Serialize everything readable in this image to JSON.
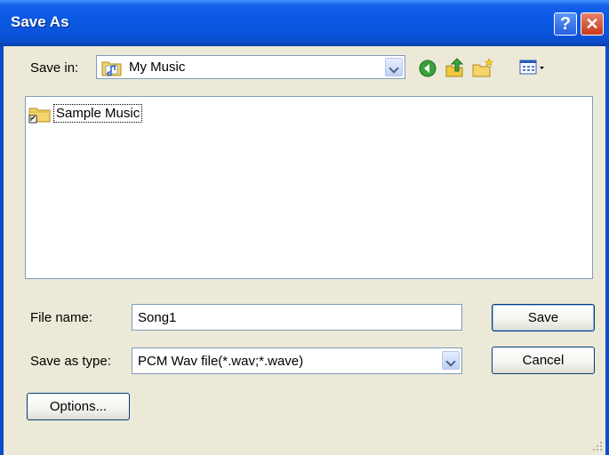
{
  "window": {
    "title": "Save As"
  },
  "title_buttons": {
    "help": "?",
    "close": "✕"
  },
  "save_in": {
    "label": "Save in:",
    "value": "My Music"
  },
  "toolbar": [
    "back-icon",
    "up-folder-icon",
    "new-folder-icon",
    "view-menu-icon"
  ],
  "files": [
    {
      "name": "Sample Music",
      "icon": "folder-shortcut-icon"
    }
  ],
  "file_name": {
    "label": "File name:",
    "value": "Song1"
  },
  "save_as_type": {
    "label": "Save as type:",
    "value": "PCM Wav file(*.wav;*.wave)"
  },
  "buttons": {
    "save": "Save",
    "cancel": "Cancel",
    "options": "Options..."
  },
  "colors": {
    "titlebar": "#0a58e4",
    "face": "#ece9d8",
    "border": "#7f9db9"
  }
}
